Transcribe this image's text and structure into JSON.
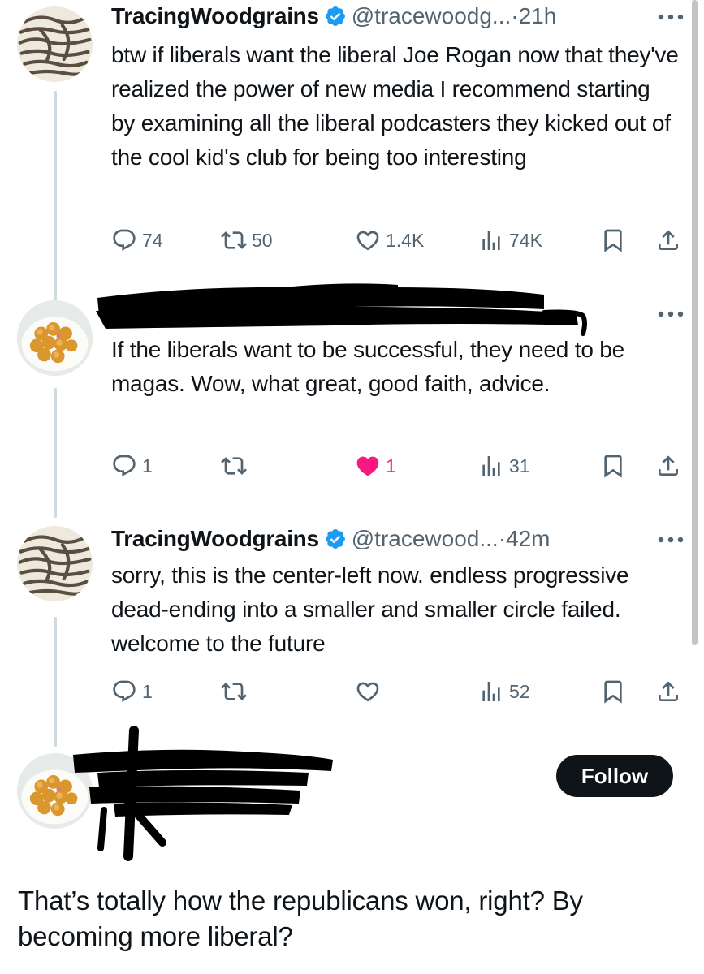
{
  "colors": {
    "text": "#0f1419",
    "secondary": "#536471",
    "verified": "#1d9bf0",
    "like": "#f91880",
    "thread_line": "#cfd9de",
    "follow_bg": "#0f1419"
  },
  "posts": [
    {
      "author_name": "TracingWoodgrains",
      "verified": true,
      "handle": "@tracewoodg...",
      "separator": "·",
      "time": "21h",
      "text": "btw if liberals want the liberal Joe Rogan now that they've realized the power of new media I recommend starting by examining all the liberal podcasters they kicked out of the cool kid's club for being too interesting",
      "stats": {
        "replies": "74",
        "reposts": "50",
        "likes": "1.4K",
        "views": "74K"
      }
    },
    {
      "author_name": "",
      "author_redacted": true,
      "text": "If the liberals want to be successful, they need to be magas. Wow, what great, good faith, advice.",
      "stats": {
        "replies": "1",
        "reposts": "",
        "likes": "1",
        "views": "31"
      },
      "liked": true
    },
    {
      "author_name": "TracingWoodgrains",
      "verified": true,
      "handle": "@tracewood...",
      "separator": "·",
      "time": "42m",
      "text": "sorry, this is the center-left now. endless progressive dead-ending into a smaller and smaller circle failed. welcome to the future",
      "stats": {
        "replies": "1",
        "reposts": "",
        "likes": "",
        "views": "52"
      }
    }
  ],
  "follow_button": {
    "label": "Follow"
  },
  "caption": "That’s totally how the republicans won, right? By becoming more liberal?",
  "icons": {
    "reply": "reply-icon",
    "repost": "repost-icon",
    "like": "heart-icon",
    "views": "views-icon",
    "bookmark": "bookmark-icon",
    "share": "share-icon",
    "more": "more-icon",
    "verified": "verified-badge-icon"
  }
}
